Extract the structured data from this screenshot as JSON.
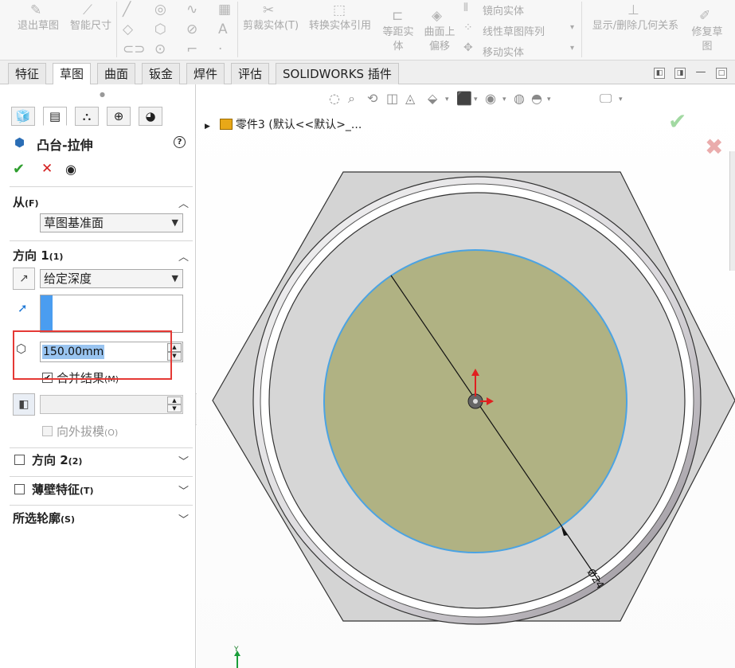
{
  "ribbon": {
    "exit_sketch": "退出草图",
    "smart_dim": "智能尺寸",
    "trim": "剪裁实体(T)",
    "convert": "转换实体引用",
    "offset_1": "等距实",
    "offset_2": "体",
    "surface_offset_1": "曲面上",
    "surface_offset_2": "偏移",
    "mirror": "镜向实体",
    "linear_pattern": "线性草图阵列",
    "move": "移动实体",
    "relations": "显示/删除几何关系",
    "repair_1": "修复草",
    "repair_2": "图"
  },
  "tabs": [
    "特征",
    "草图",
    "曲面",
    "钣金",
    "焊件",
    "评估",
    "SOLIDWORKS 插件"
  ],
  "panel": {
    "title": "凸台-拉伸",
    "from": {
      "label": "从",
      "key": "(F)",
      "value": "草图基准面"
    },
    "direction1": {
      "label": "方向 1",
      "key": "(1)",
      "end_condition": "给定深度",
      "depth": "150.00mm",
      "merge_label": "合并结果",
      "merge_key": "(M)",
      "draft_label": "向外拔模",
      "draft_key": "(O)"
    },
    "direction2": {
      "label": "方向 2",
      "key": "(2)"
    },
    "thin": {
      "label": "薄壁特征",
      "key": "(T)"
    },
    "contours": {
      "label": "所选轮廓",
      "key": "(S)"
    }
  },
  "viewport": {
    "tree_label": "零件3 (默认<<默认>_...",
    "dimension": "Ø24",
    "axis_label": "Y"
  },
  "colors": {
    "accent": "#1e78d6",
    "selection_box": "#e53935",
    "sketch_fill": "#b0b283",
    "sketch_outline": "#4ba3e3"
  }
}
